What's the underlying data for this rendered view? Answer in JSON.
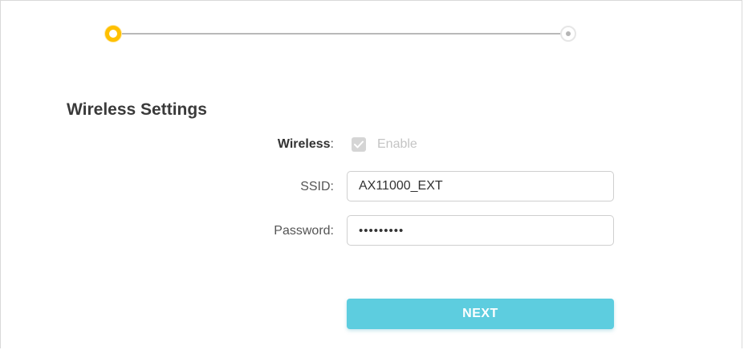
{
  "stepper": {
    "current_step": 1,
    "total_steps": 2,
    "active_color": "#ffc000",
    "inactive_color": "#b5b5b5"
  },
  "section": {
    "title": "Wireless Settings"
  },
  "wireless": {
    "label": "Wireless",
    "colon": ":",
    "checkbox_checked": true,
    "checkbox_disabled": true,
    "enable_label": "Enable"
  },
  "ssid": {
    "label": "SSID:",
    "value": "AX11000_EXT"
  },
  "password": {
    "label": "Password:",
    "value": "•••••••••"
  },
  "actions": {
    "next_label": "NEXT",
    "next_color": "#5dcddf"
  },
  "icons": {
    "checkmark": "check-icon"
  }
}
